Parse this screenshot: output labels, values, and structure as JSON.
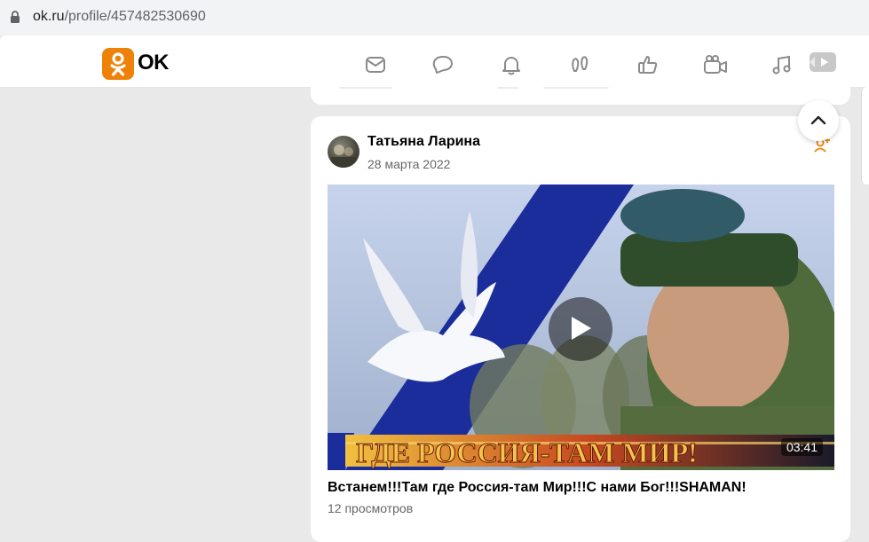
{
  "browser": {
    "url_domain": "ok.ru",
    "url_path": "/profile/457482530690"
  },
  "nav": {
    "logo_text": "OK",
    "icons": [
      "messages-icon",
      "discussions-icon",
      "notifications-icon",
      "guests-icon",
      "events-icon",
      "video-icon",
      "music-icon",
      "video-showcase-icon"
    ]
  },
  "post": {
    "author": "Татьяна Ларина",
    "date": "28 марта 2022",
    "video": {
      "banner_text": "ГДЕ РОССИЯ-ТАМ МИР!",
      "duration": "03:41"
    },
    "title": "Встанем!!!Там где Россия-там Мир!!!С нами Бог!!!SHAMAN!",
    "views": "12 просмотров"
  },
  "colors": {
    "brand": "#ee8208",
    "page_bg": "#e9e9ea"
  }
}
